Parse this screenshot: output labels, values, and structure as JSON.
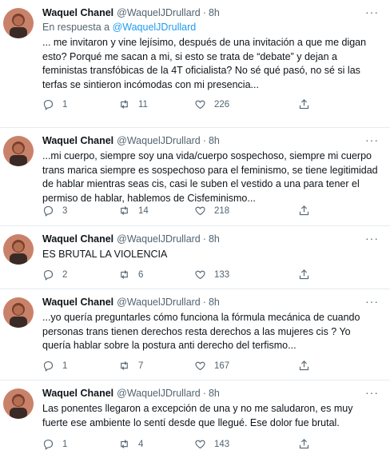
{
  "tweets": [
    {
      "name": "Waquel Chanel",
      "handle": "@WaquelJDrullard",
      "time": "8h",
      "reply_prefix": "En respuesta a",
      "reply_to": "@WaquelJDrullard",
      "text": "... me invitaron y vine lejísimo, después de una invitación a que me digan esto? Porqué me sacan a mi, si esto se trata de “debate” y dejan a feministas transfóbicas de la 4T oficialista? No sé qué pasó, no sé si las terfas se sintieron incómodas con mi presencia...",
      "replies": "1",
      "retweets": "11",
      "likes": "226"
    },
    {
      "name": "Waquel Chanel",
      "handle": "@WaquelJDrullard",
      "time": "8h",
      "text": "...mi cuerpo, siempre soy una vida/cuerpo sospechoso, siempre mi cuerpo trans marica siempre es sospechoso para el feminismo, se tiene legitimidad de hablar mientras seas cis, casi le suben el vestido a una para tener el permiso de hablar, hablemos de Cisfeminismo...",
      "replies": "3",
      "retweets": "14",
      "likes": "218"
    },
    {
      "name": "Waquel Chanel",
      "handle": "@WaquelJDrullard",
      "time": "8h",
      "text": "ES BRUTAL LA VIOLENCIA",
      "replies": "2",
      "retweets": "6",
      "likes": "133"
    },
    {
      "name": "Waquel Chanel",
      "handle": "@WaquelJDrullard",
      "time": "8h",
      "text": "...yo quería preguntarles cómo funciona la fórmula mecánica de cuando personas trans tienen derechos resta derechos a las mujeres cis ? Yo quería hablar sobre la postura anti derecho del terfismo...",
      "replies": "1",
      "retweets": "7",
      "likes": "167"
    },
    {
      "name": "Waquel Chanel",
      "handle": "@WaquelJDrullard",
      "time": "8h",
      "text": "Las ponentes llegaron a excepción de una y no me saludaron, es muy fuerte ese ambiente lo sentí desde que llegué.  Ese dolor fue brutal.",
      "replies": "1",
      "retweets": "4",
      "likes": "143"
    }
  ],
  "icons": [
    "more-icon",
    "reply-icon",
    "retweet-icon",
    "like-icon",
    "share-icon"
  ],
  "colors": {
    "text": "#0f1419",
    "secondary": "#536471",
    "link": "#1d9bf0",
    "divider": "#e6ecf0"
  }
}
